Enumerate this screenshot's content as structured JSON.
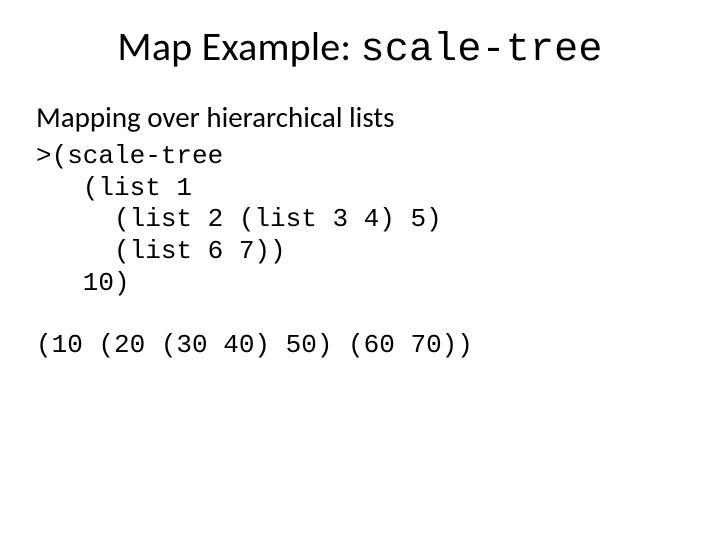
{
  "slide": {
    "title_prefix": "Map Example: ",
    "title_mono": "scale-tree",
    "subtitle": "Mapping over hierarchical lists",
    "code": ">(scale-tree\n   (list 1\n     (list 2 (list 3 4) 5)\n     (list 6 7))\n   10)",
    "output": "(10 (20 (30 40) 50) (60 70))"
  }
}
